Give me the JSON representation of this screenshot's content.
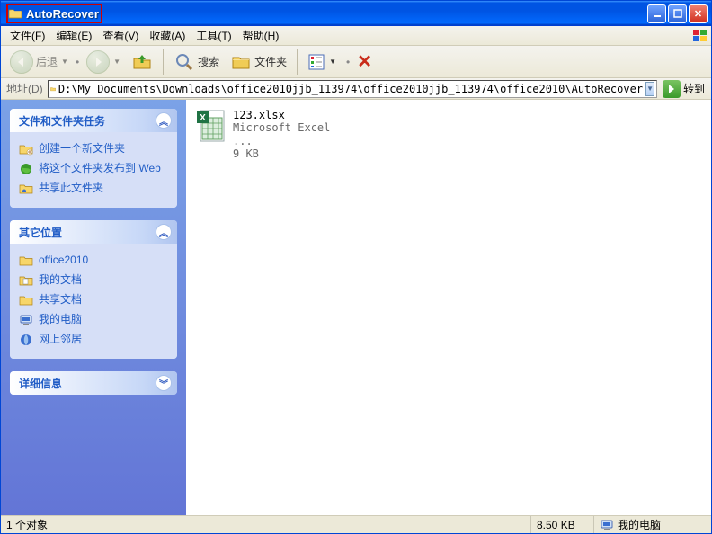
{
  "window": {
    "title": "AutoRecover"
  },
  "menu": {
    "file": "文件(F)",
    "edit": "编辑(E)",
    "view": "查看(V)",
    "favorites": "收藏(A)",
    "tools": "工具(T)",
    "help": "帮助(H)"
  },
  "toolbar": {
    "back": "后退",
    "search": "搜索",
    "folders": "文件夹"
  },
  "address": {
    "label": "地址(D)",
    "path": "D:\\My Documents\\Downloads\\office2010jjb_113974\\office2010jjb_113974\\office2010\\AutoRecover",
    "go": "转到"
  },
  "sidepanel": {
    "tasks": {
      "title": "文件和文件夹任务",
      "items": [
        "创建一个新文件夹",
        "将这个文件夹发布到 Web",
        "共享此文件夹"
      ]
    },
    "other": {
      "title": "其它位置",
      "items": [
        "office2010",
        "我的文档",
        "共享文档",
        "我的电脑",
        "网上邻居"
      ]
    },
    "details": {
      "title": "详细信息"
    }
  },
  "files": [
    {
      "name": "123.xlsx",
      "type": "Microsoft Excel ...",
      "size": "9 KB"
    }
  ],
  "status": {
    "count": "1 个对象",
    "size": "8.50 KB",
    "location": "我的电脑"
  }
}
